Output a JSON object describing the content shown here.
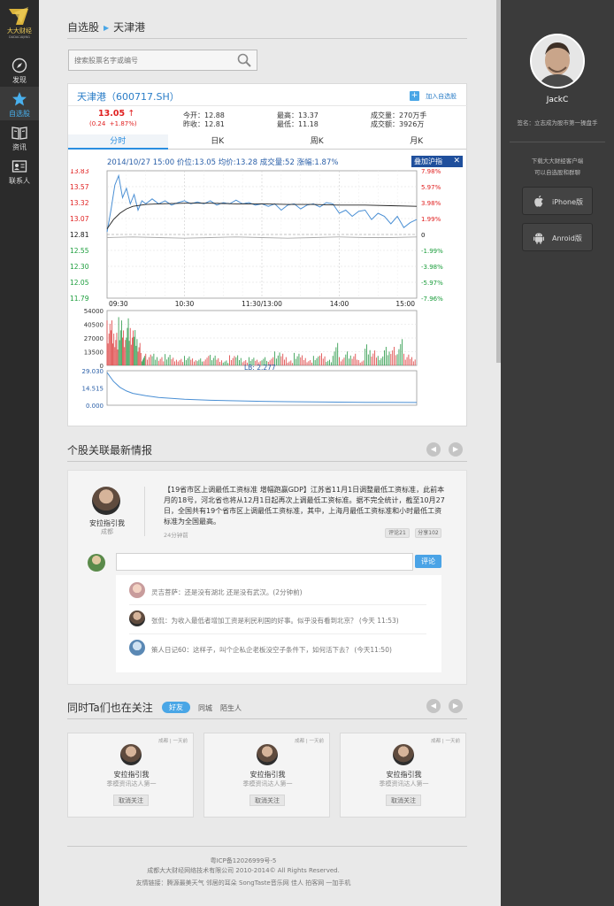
{
  "nav": {
    "logo_text": "大大财经",
    "logo_sub": "DADACAIJING",
    "items": [
      {
        "label": "发现",
        "icon": "compass-icon"
      },
      {
        "label": "自选股",
        "icon": "star-icon"
      },
      {
        "label": "资讯",
        "icon": "book-icon"
      },
      {
        "label": "联系人",
        "icon": "contact-card-icon"
      }
    ]
  },
  "breadcrumb": {
    "parent": "自选股",
    "current": "天津港"
  },
  "search": {
    "placeholder": "搜索股票名字或编号"
  },
  "stock": {
    "name": "天津港（600717.SH）",
    "add_label": "加入自选股",
    "price": "13.05",
    "change": "(0.24",
    "change_pct": "+1.87%)",
    "today_open": "今开：12.88",
    "prev_close": "昨收：12.81",
    "high": "最高：13.37",
    "low": "最低：11.18",
    "volume": "成交量：270万手",
    "turnover": "成交额：3926万",
    "tabs": [
      "分时",
      "日K",
      "周K",
      "月K"
    ],
    "chart_header": "2014/10/27 15:00  价位:13.05  均价:13.28  成交量:52  涨幅:1.87%",
    "overlay_label": "叠加沪指",
    "lb_label": "LB: 2.277"
  },
  "chart_data": {
    "type": "line",
    "title": "",
    "x_ticks": [
      "09:30",
      "10:30",
      "11:30/13:00",
      "14:00",
      "15:00"
    ],
    "y_left_ticks": [
      "13.83",
      "13.57",
      "13.32",
      "13.07",
      "12.81",
      "12.55",
      "12.30",
      "12.05",
      "11.79"
    ],
    "y_right_ticks": [
      "7.98%",
      "5.97%",
      "3.98%",
      "1.99%",
      "0",
      "-1.99%",
      "-3.98%",
      "-5.97%",
      "-7.96%"
    ],
    "ylim": [
      11.79,
      13.83
    ],
    "prev_close": 12.81,
    "series": [
      {
        "name": "价位",
        "color": "#4a8fd4",
        "x": [
          0,
          3,
          6,
          9,
          12,
          15,
          18,
          21,
          24,
          27,
          30,
          35,
          40,
          45,
          50,
          55,
          60,
          65,
          70,
          75,
          80,
          85,
          90,
          95,
          100,
          105,
          110,
          115,
          120,
          125,
          130,
          135,
          140,
          145,
          150,
          155,
          160,
          165,
          170,
          175,
          180,
          185,
          190,
          195,
          200,
          205,
          210,
          215,
          220,
          225,
          230,
          235,
          240
        ],
        "y": [
          12.85,
          13.2,
          13.6,
          13.75,
          13.4,
          13.55,
          13.3,
          13.45,
          13.2,
          13.35,
          13.3,
          13.38,
          13.3,
          13.35,
          13.28,
          13.32,
          13.35,
          13.3,
          13.33,
          13.3,
          13.35,
          13.28,
          13.32,
          13.3,
          13.36,
          13.3,
          13.32,
          13.28,
          13.3,
          13.26,
          13.3,
          13.2,
          13.28,
          13.3,
          13.22,
          13.28,
          13.3,
          13.25,
          13.32,
          13.3,
          13.15,
          13.2,
          13.1,
          13.18,
          13.2,
          13.05,
          13.15,
          13.1,
          12.98,
          13.1,
          12.92,
          13.0,
          13.05
        ]
      },
      {
        "name": "均价",
        "color": "#222222",
        "x": [
          0,
          5,
          10,
          15,
          20,
          30,
          40,
          60,
          80,
          100,
          120,
          140,
          160,
          180,
          200,
          220,
          240
        ],
        "y": [
          12.9,
          13.05,
          13.15,
          13.22,
          13.26,
          13.29,
          13.3,
          13.31,
          13.31,
          13.3,
          13.3,
          13.29,
          13.29,
          13.28,
          13.28,
          13.27,
          13.26
        ]
      },
      {
        "name": "沪指",
        "color": "#aaaaaa",
        "x": [
          0,
          20,
          40,
          60,
          80,
          100,
          120,
          140,
          160,
          180,
          200,
          220,
          240
        ],
        "y": [
          12.76,
          12.77,
          12.76,
          12.75,
          12.76,
          12.77,
          12.76,
          12.75,
          12.76,
          12.77,
          12.76,
          12.76,
          12.77
        ]
      }
    ],
    "volume": {
      "y_ticks": [
        "54000",
        "40500",
        "27000",
        "13500",
        "0"
      ],
      "ylim": [
        0,
        54000
      ]
    },
    "lb": {
      "y_ticks": [
        "29.030",
        "14.515",
        "0.000"
      ],
      "ylim": [
        0,
        29.03
      ],
      "x": [
        0,
        5,
        10,
        15,
        20,
        30,
        40,
        60,
        80,
        100,
        120,
        140,
        160,
        180,
        200,
        220,
        240
      ],
      "y": [
        27.5,
        20,
        15,
        12,
        10,
        8,
        6.5,
        5,
        4.2,
        3.7,
        3.3,
        3,
        2.8,
        2.6,
        2.45,
        2.35,
        2.28
      ]
    }
  },
  "news": {
    "title": "个股关联最新情报",
    "user": "安拉指引我",
    "location": "成都",
    "body": "【19省市区上调最低工资标准 增幅跑赢GDP】江苏省11月1日调整最低工资标准，此前本月的18号，河北省也将从12月1日起再次上调最低工资标准。据不完全统计，截至10月27日，全国共有19个省市区上调最低工资标准，其中，上海月最低工资标准和小时最低工资标准为全国最高。",
    "time": "24分钟前",
    "comments_label": "评论21",
    "share_label": "分享102",
    "comment_button": "评论",
    "comments": [
      "灵吉菩萨：还是没有湖北 还是没有武汉。(2分钟前)",
      "张侃：为收入最低者增加工资是利民利国的好事。似乎没有看到北京？ (今天 11:53)",
      "策人日记60：这样子，叫个企私企老板没空子条件下，如何活下去？ (今天11:50)"
    ]
  },
  "follow": {
    "title": "同时Ta们也在关注",
    "tabs": [
      "好友",
      "同城",
      "陌生人"
    ],
    "cards": [
      {
        "meta": "成都 | 一天前",
        "name": "安拉指引我",
        "desc": "季模资讯达人第一",
        "button": "取消关注"
      },
      {
        "meta": "成都 | 一天前",
        "name": "安拉指引我",
        "desc": "季模资讯达人第一",
        "button": "取消关注"
      },
      {
        "meta": "成都 | 一天前",
        "name": "安拉指引我",
        "desc": "季模资讯达人第一",
        "button": "取消关注"
      }
    ]
  },
  "footer": {
    "icp": "粤ICP备12026999号-5",
    "copyright": "成都大大财经网络技术有限公司 2010-2014© All Rights Reserved.",
    "links": "友情链接：腾源最美天气  邻居的耳朵  SongTaste音乐网  佳人  拍客网  一加手机"
  },
  "profile": {
    "name": "JackC",
    "signature": "签名：立志成为股市第一操盘手",
    "download_line1": "下载大大财经客户端",
    "download_line2": "可以自选股和群聊",
    "iphone_label": "iPhone版",
    "android_label": "Anroid版"
  },
  "colors": {
    "accent": "#49a6e6",
    "up": "#e02020",
    "down": "#1a9d3b",
    "nav_bg": "#2b2b2b",
    "right_bg": "#3b3b3b"
  }
}
